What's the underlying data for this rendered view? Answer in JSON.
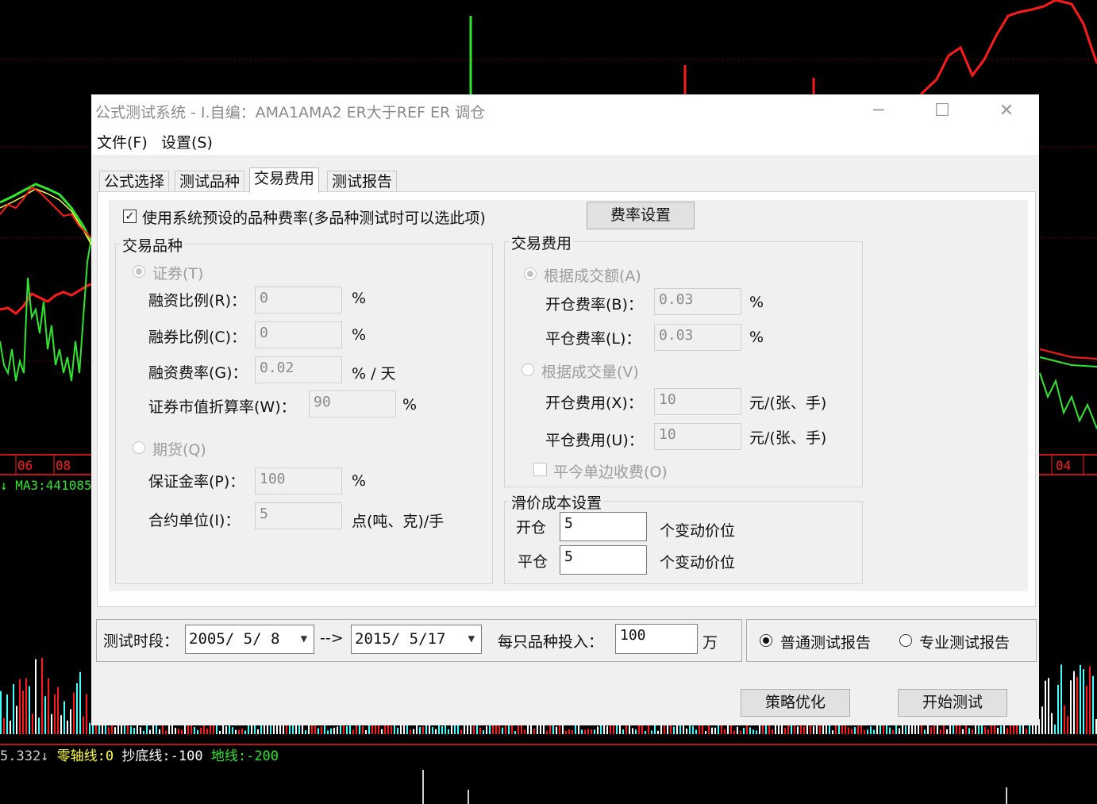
{
  "window": {
    "title": "公式测试系统 - I.自编：AMA1AMA2 ER大于REF ER 调仓",
    "minimize_glyph": "─",
    "maximize_glyph": "☐",
    "close_glyph": "✕"
  },
  "menu": {
    "file": "文件(F)",
    "settings": "设置(S)"
  },
  "tabs": [
    {
      "label": "公式选择",
      "active": false
    },
    {
      "label": "测试品种",
      "active": false
    },
    {
      "label": "交易费用",
      "active": true
    },
    {
      "label": "测试报告",
      "active": false
    }
  ],
  "fee_panel": {
    "use_system_default": {
      "label": "使用系统预设的品种费率(多品种测试时可以选此项)",
      "checked": true
    },
    "rate_settings_button": "费率设置",
    "trade_type": {
      "legend": "交易品种",
      "securities": {
        "label": "证券(T)",
        "selected": true,
        "margin_ratio": {
          "label": "融资比例(R)：",
          "value": "0",
          "unit": "%"
        },
        "short_ratio": {
          "label": "融券比例(C)：",
          "value": "0",
          "unit": "%"
        },
        "financing_rate": {
          "label": "融资费率(G)：",
          "value": "0.02",
          "unit": "% / 天"
        },
        "discount_rate": {
          "label": "证券市值折算率(W)：",
          "value": "90",
          "unit": "%"
        }
      },
      "futures": {
        "label": "期货(Q)",
        "selected": false,
        "margin_rate": {
          "label": "保证金率(P)：",
          "value": "100",
          "unit": "%"
        },
        "contract_unit": {
          "label": "合约单位(I)：",
          "value": "5",
          "unit": "点(吨、克)/手"
        }
      }
    },
    "trade_fee": {
      "legend": "交易费用",
      "by_amount": {
        "label": "根据成交额(A)",
        "selected": true,
        "open_rate": {
          "label": "开仓费率(B)：",
          "value": "0.03",
          "unit": "%"
        },
        "close_rate": {
          "label": "平仓费率(L)：",
          "value": "0.03",
          "unit": "%"
        }
      },
      "by_volume": {
        "label": "根据成交量(V)",
        "selected": false,
        "open_fee": {
          "label": "开仓费用(X)：",
          "value": "10",
          "unit": "元/(张、手)"
        },
        "close_fee": {
          "label": "平仓费用(U)：",
          "value": "10",
          "unit": "元/(张、手)"
        }
      },
      "single_side": {
        "label": "平今单边收费(O)",
        "checked": false
      }
    },
    "slippage": {
      "legend": "滑价成本设置",
      "open": {
        "label": "开仓",
        "value": "5",
        "unit": "个变动价位"
      },
      "close": {
        "label": "平仓",
        "value": "5",
        "unit": "个变动价位"
      }
    }
  },
  "bottom": {
    "period_label": "测试时段：",
    "start_date": "2005/ 5/ 8",
    "arrow": "-->",
    "end_date": "2015/ 5/17",
    "invest_label": "每只品种投入：",
    "invest_value": "100",
    "invest_unit": "万",
    "report_normal": {
      "label": "普通测试报告",
      "selected": true
    },
    "report_pro": {
      "label": "专业测试报告",
      "selected": false
    },
    "optimize_button": "策略优化",
    "start_button": "开始测试"
  },
  "background": {
    "dates_left": [
      "06",
      "08"
    ],
    "date_right": "04",
    "ma3_label": "MA3:441085.",
    "indicator_prefix": "5.332↓",
    "zero_line": "零轴线:0",
    "bottom_line": "抄底线:-100",
    "ground_line": "地线:-200",
    "colors": {
      "red": "#ff1a1a",
      "green": "#2ee62e",
      "yellow": "#ffff40",
      "cyan": "#40ffff"
    }
  }
}
